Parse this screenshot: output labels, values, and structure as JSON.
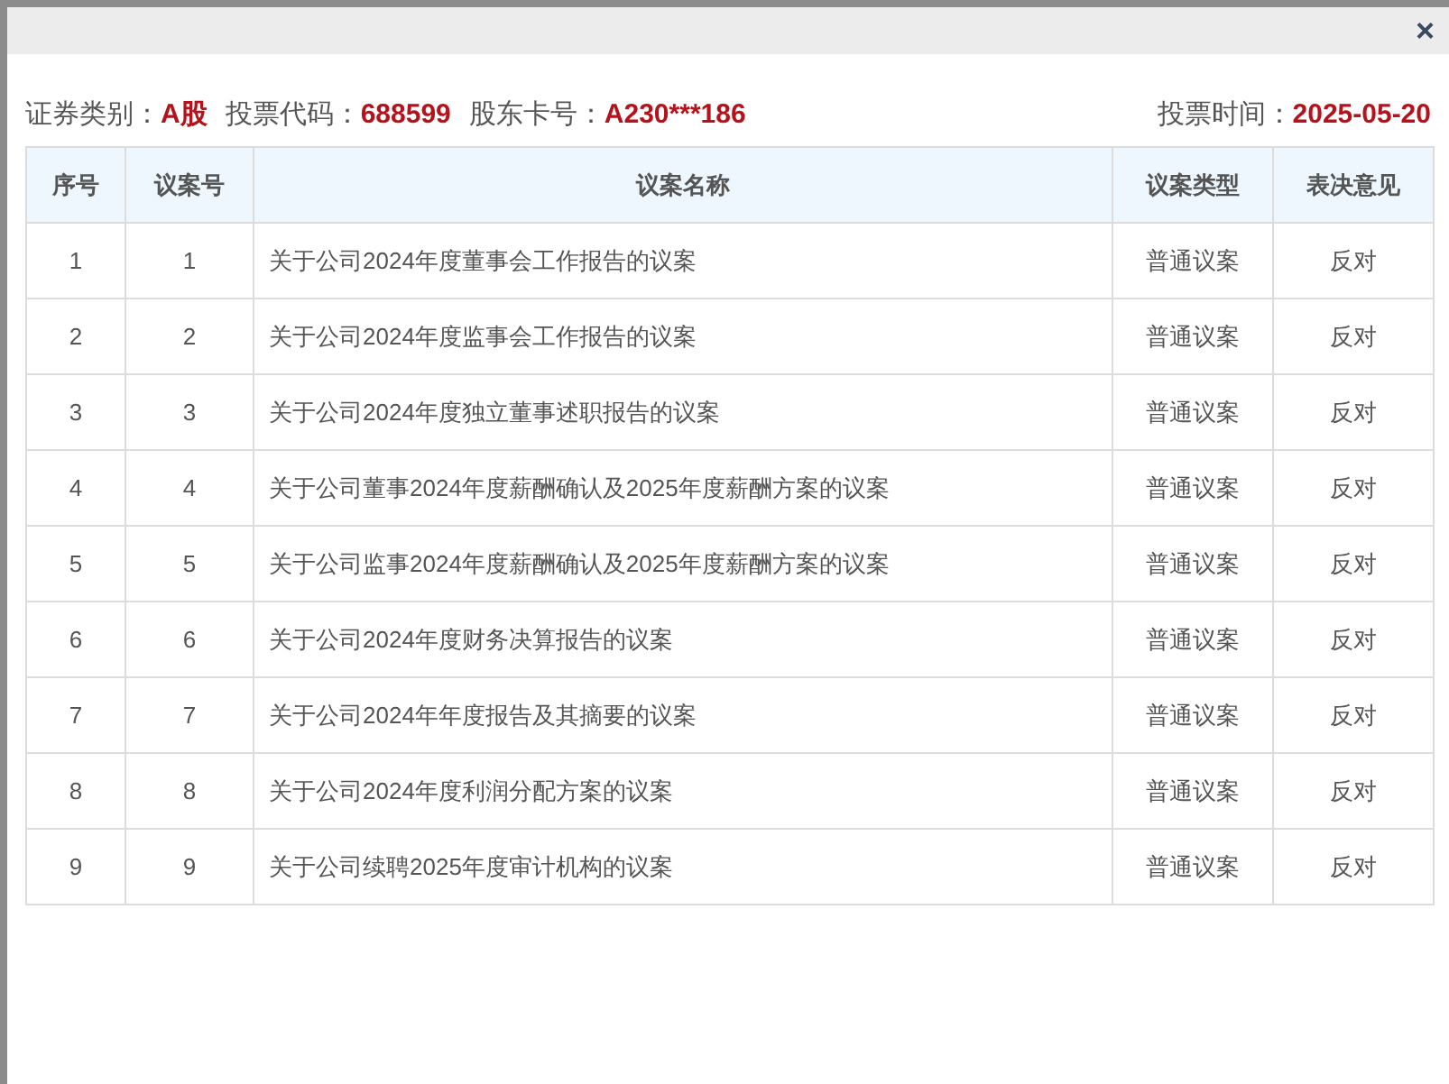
{
  "info": {
    "fields": [
      {
        "label": "证券类别：",
        "value": "A股"
      },
      {
        "label": "投票代码：",
        "value": "688599"
      },
      {
        "label": "股东卡号：",
        "value": "A230***186"
      }
    ],
    "date": {
      "label": "投票时间：",
      "value": "2025-05-20"
    }
  },
  "close": "×",
  "table": {
    "columns": [
      "序号",
      "议案号",
      "议案名称",
      "议案类型",
      "表决意见"
    ],
    "rows": [
      [
        "1",
        "1",
        "关于公司2024年度董事会工作报告的议案",
        "普通议案",
        "反对"
      ],
      [
        "2",
        "2",
        "关于公司2024年度监事会工作报告的议案",
        "普通议案",
        "反对"
      ],
      [
        "3",
        "3",
        "关于公司2024年度独立董事述职报告的议案",
        "普通议案",
        "反对"
      ],
      [
        "4",
        "4",
        "关于公司董事2024年度薪酬确认及2025年度薪酬方案的议案",
        "普通议案",
        "反对"
      ],
      [
        "5",
        "5",
        "关于公司监事2024年度薪酬确认及2025年度薪酬方案的议案",
        "普通议案",
        "反对"
      ],
      [
        "6",
        "6",
        "关于公司2024年度财务决算报告的议案",
        "普通议案",
        "反对"
      ],
      [
        "7",
        "7",
        "关于公司2024年年度报告及其摘要的议案",
        "普通议案",
        "反对"
      ],
      [
        "8",
        "8",
        "关于公司2024年度利润分配方案的议案",
        "普通议案",
        "反对"
      ],
      [
        "9",
        "9",
        "关于公司续聘2025年度审计机构的议案",
        "普通议案",
        "反对"
      ]
    ]
  }
}
